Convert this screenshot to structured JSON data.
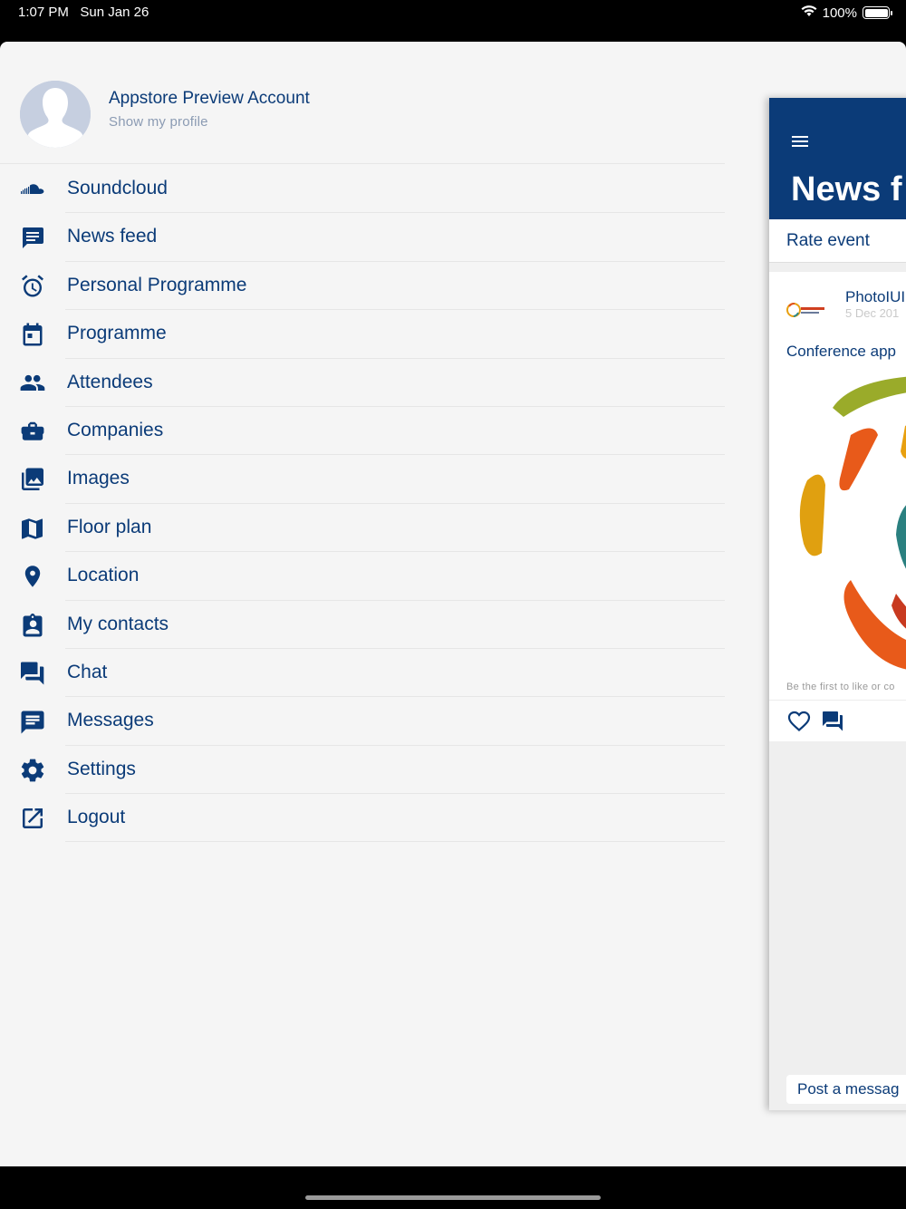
{
  "status_bar": {
    "time": "1:07 PM",
    "date": "Sun Jan 26",
    "battery": "100%",
    "wifi_icon": "wifi-icon",
    "battery_icon": "battery-icon"
  },
  "profile": {
    "name": "Appstore Preview Account",
    "subtitle": "Show my profile"
  },
  "menu": {
    "items": [
      {
        "label": "Soundcloud",
        "icon": "soundcloud-icon"
      },
      {
        "label": "News feed",
        "icon": "chat-bubble-icon"
      },
      {
        "label": "Personal Programme",
        "icon": "alarm-clock-icon"
      },
      {
        "label": "Programme",
        "icon": "calendar-icon"
      },
      {
        "label": "Attendees",
        "icon": "people-icon"
      },
      {
        "label": "Companies",
        "icon": "briefcase-icon"
      },
      {
        "label": "Images",
        "icon": "photo-library-icon"
      },
      {
        "label": "Floor plan",
        "icon": "map-icon"
      },
      {
        "label": "Location",
        "icon": "location-pin-icon"
      },
      {
        "label": "My contacts",
        "icon": "contact-card-icon"
      },
      {
        "label": "Chat",
        "icon": "forum-icon"
      },
      {
        "label": "Messages",
        "icon": "message-icon"
      },
      {
        "label": "Settings",
        "icon": "gear-icon"
      },
      {
        "label": "Logout",
        "icon": "external-link-icon"
      }
    ]
  },
  "news_panel": {
    "title": "News f",
    "rate_event": "Rate event",
    "post": {
      "author": "PhotoIUI",
      "date": "5 Dec 201",
      "text": "Conference app",
      "likes_text": "Be the first to like or co"
    },
    "post_message": "Post a messag"
  },
  "colors": {
    "brand": "#0b3b78",
    "background": "#f5f5f5",
    "divider": "#e6e6e6"
  }
}
